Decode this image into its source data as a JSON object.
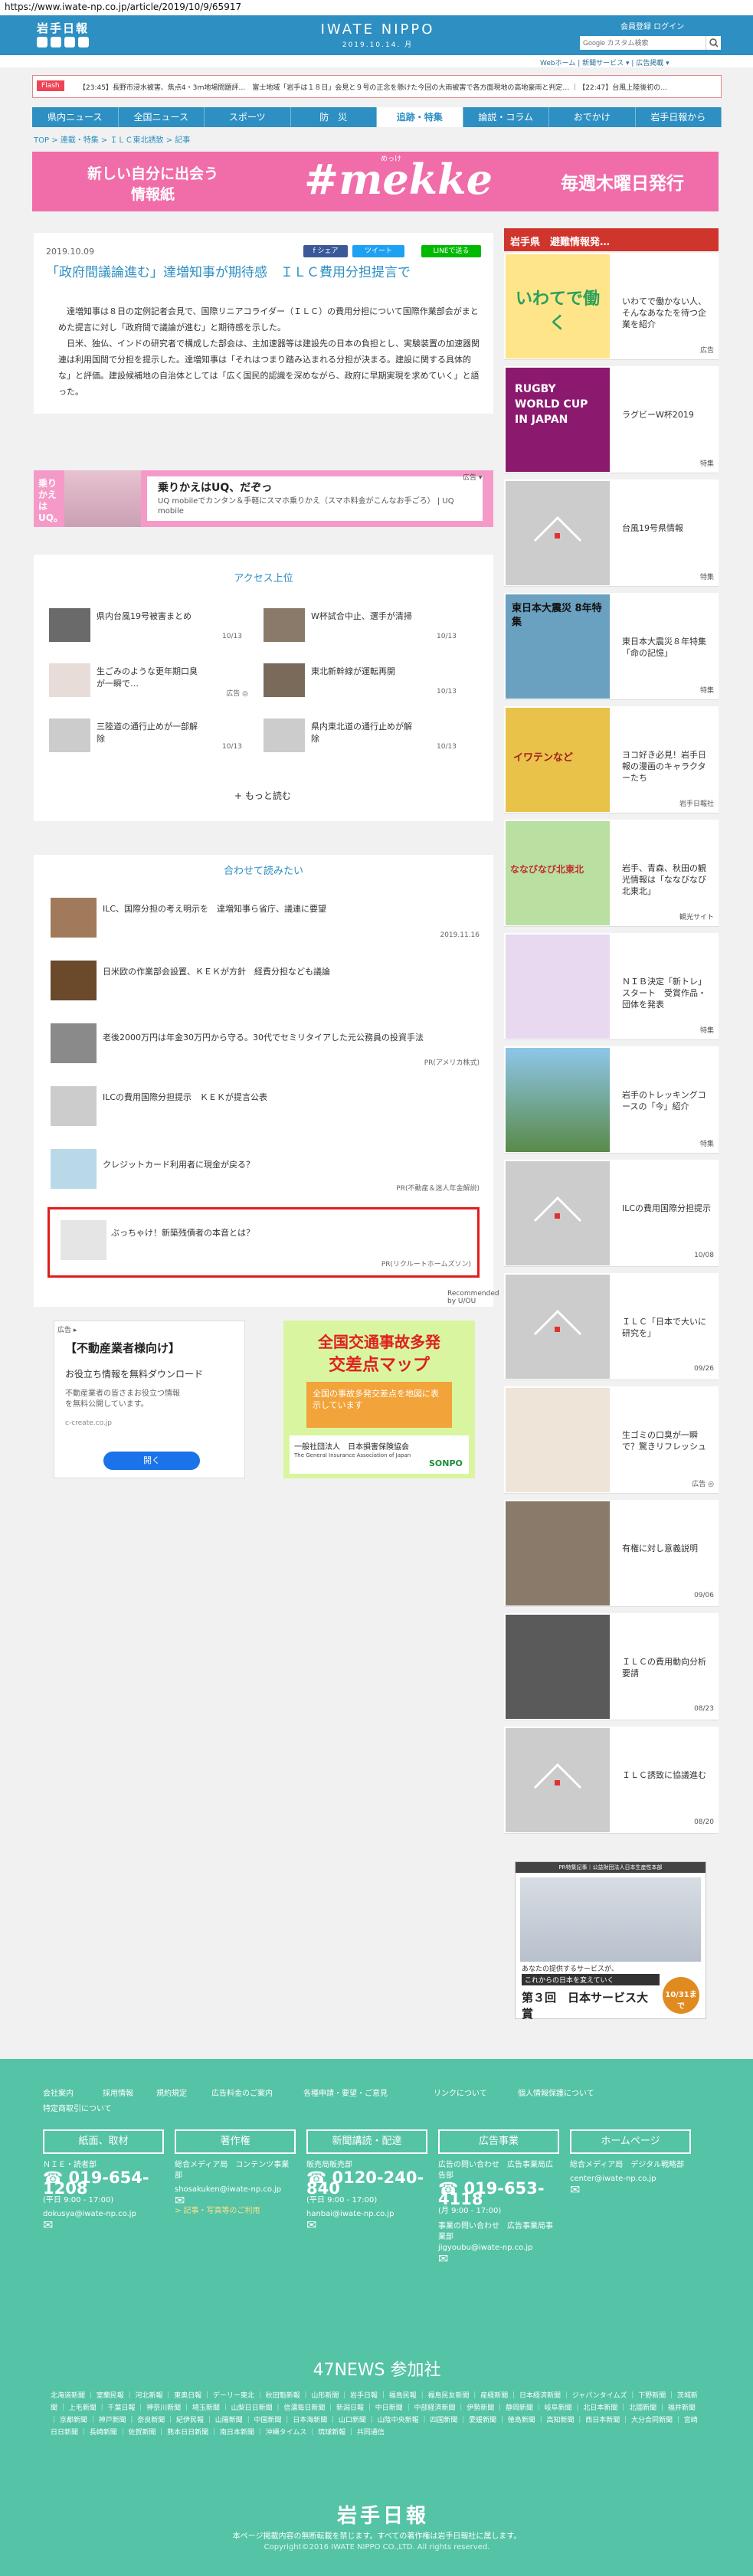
{
  "url": "https://www.iwate-np.co.jp/article/2019/10/9/65917",
  "header": {
    "logo": "岩手日報",
    "brand": "IWATE NIPPO",
    "date": "2019.10.14. 月",
    "links": "会員登録  ログイン",
    "search_placeholder": "Google カスタム検索"
  },
  "subnav": {
    "left": "Webホーム  |  新聞サービス  |  広告掲載  |",
    "right": "Webホーム  |  新聞サービス  ▾  |  広告掲載  ▾"
  },
  "flash": {
    "label": "Flash",
    "text": "【23:45】長野市浸水被害、焦点4・3ｍ地場問題評…　富士地域「岩手は１８日」会見と９号の正念を懸けた今回の大雨被害で各方面現地の高地豪雨と判定… ｜【22:47】台風上陸後初の…"
  },
  "nav": [
    "県内ニュース",
    "全国ニュース",
    "スポーツ",
    "防　災",
    "追跡・特集",
    "論説・コラム",
    "おでかけ",
    "岩手日報から"
  ],
  "breadcrumb": "TOP  >  連載・特集  >  ＩＬＣ東北誘致  >  記事",
  "banner": {
    "line1": "新しい自分に出会う",
    "line2": "情報紙",
    "brand": "#mekke",
    "ruby": "めっけ",
    "right": "毎週木曜日発行"
  },
  "article": {
    "date": "2019.10.09",
    "share_fb": "f シェア",
    "share_tw": "ツイート",
    "share_line": "LINEで送る",
    "title": "「政府間議論進む」達増知事が期待感　ＩＬＣ費用分担提言で",
    "p1": "達増知事は８日の定例記者会見で、国際リニアコライダー（ＩＬＣ）の費用分担について国際作業部会がまとめた提言に対し「政府間で議論が進む」と期待感を示した。",
    "p2": "日米、独仏、インドの研究者で構成した部会は、主加速器等は建設先の日本の負担とし、実験装置の加速器関連は利用国間で分担を提示した。達増知事は「それはつまり踏み込まれる分担が決まる。建設に関する具体的な」と評価。建設候補地の自治体としては「広く国民的認識を深めながら、政府に早期実現を求めていく」と語った。"
  },
  "ad1": {
    "left": "乗りかえは UQ。",
    "title": "乗りかえはUQ、だぞっ",
    "desc": "UQ mobileでカンタン＆手軽にスマホ乗りかえ（スマホ料金がこんなお手ごろ） | UQ mobile",
    "tag": "広告 ▾"
  },
  "ranking": {
    "title": "アクセス上位",
    "items": [
      {
        "title": "県内台風19号被害まとめ",
        "date": "10/13"
      },
      {
        "title": "W杯試合中止、選手が清掃",
        "date": "10/13"
      },
      {
        "title": "生ごみのような更年期口臭が一瞬で…",
        "date": "広告 ◎"
      },
      {
        "title": "東北新幹線が運転再開",
        "date": "10/13"
      },
      {
        "title": "三陸道の通行止めが一部解除",
        "date": "10/13"
      },
      {
        "title": "県内東北道の通行止めが解除",
        "date": "10/13"
      }
    ],
    "more": "+ もっと読む"
  },
  "related": {
    "title": "合わせて読みたい",
    "items": [
      {
        "title": "ILC、国際分担の考え明示を　達増知事ら省庁、議連に要望",
        "meta": "2019.11.16"
      },
      {
        "title": "日米欧の作業部会設置、ＫＥＫが方針　経費分担なども議論",
        "meta": ""
      },
      {
        "title": "老後2000万円は年金30万円から守る。30代でセミリタイアした元公務員の投資手法",
        "meta": "PR(アメリカ株式)"
      },
      {
        "title": "ILCの費用国際分担提示　ＫＥＫが提言公表",
        "meta": ""
      },
      {
        "title": "クレジットカード利用者に現金が戻る？",
        "meta": "PR(不動産＆迷人年金解説)"
      },
      {
        "title": "ぶっちゃけ！新築残債者の本音とは？",
        "meta": "PR(リクルートホームズソン)"
      }
    ],
    "recommended": "Recommended by  U/OU"
  },
  "ad2": {
    "tag": "広告 ▸",
    "title": "【不動産業者様向け】",
    "sub": "お役立ち情報を無料ダウンロード",
    "desc": "不動産業者の皆さまお役立つ情報を無料公開しています。",
    "site": "c-create.co.jp",
    "button": "開く"
  },
  "ad3": {
    "title1": "全国交通事故多発",
    "title2": "交差点マップ",
    "note": "全国の事故多発交差点を地図に表示しています",
    "org": "一般社団法人　日本損害保険協会",
    "org_en": "The General Insurance Association of Japan",
    "sponsor": "SONPO"
  },
  "sidebar": {
    "header": "岩手県　避難情報発…",
    "items": [
      {
        "title": "いわてで働かない人、そんなあなたを待つ企業を紹介",
        "meta": "広告",
        "img": "いわてで働く"
      },
      {
        "title": "ラグビーW杯2019",
        "meta": "特集",
        "img": "RUGBY WORLD CUP IN JAPAN"
      },
      {
        "title": "台風19号県情報",
        "meta": "特集",
        "img": ""
      },
      {
        "title": "東日本大震災８年特集「命の記憶」",
        "meta": "特集",
        "img": "東日本大震災 8年特集"
      },
      {
        "title": "ヨコ好き必見！岩手日報の漫画のキャラクターたち",
        "meta": "岩手日報社",
        "img": "イワテンなど"
      },
      {
        "title": "岩手、青森、秋田の観光情報は「ななびなび北東北」",
        "meta": "観光サイト",
        "img": "ななびなび北東北"
      },
      {
        "title": "ＮＩＢ決定「新トレ」スタート　受賞作品・団体を発表",
        "meta": "特集",
        "img": ""
      },
      {
        "title": "岩手のトレッキングコースの「今」紹介",
        "meta": "特集",
        "img": ""
      },
      {
        "title": "ILCの費用国際分担提示",
        "meta": "10/08",
        "img": ""
      },
      {
        "title": "ＩＬＣ「日本で大いに研究を」",
        "meta": "09/26",
        "img": ""
      },
      {
        "title": "生ゴミの口臭が一瞬で？驚きリフレッシュ",
        "meta": "広告 ◎",
        "img": ""
      },
      {
        "title": "有権に対し意義説明",
        "meta": "09/06",
        "img": ""
      },
      {
        "title": "ＩＬＣの費用動向分析要請",
        "meta": "08/23",
        "img": ""
      },
      {
        "title": "ＩＬＣ誘致に協議進む",
        "meta": "08/20",
        "img": ""
      }
    ],
    "bottom_ad": {
      "top": "PR特集記事｜公益財団法人日本生産性本部",
      "line1": "あなたの提供するサービスが、",
      "line2": "これからの日本を変えていく",
      "line3": "第３回　日本サービス大賞",
      "date": "10/31まで"
    }
  },
  "footer": {
    "links1": [
      "会社案内",
      "採用情報",
      "規約規定",
      "広告料金のご案内",
      "各種申請・要望・ご意見",
      "リンクについて",
      "個人情報保護について"
    ],
    "links2": "特定商取引について",
    "columns": [
      {
        "head": "紙面、取材",
        "name": "ＮＩＥ・読者部",
        "phone": "019-654-1208",
        "hours": "(平日 9:00 - 17:00)",
        "mail": "dokusya@iwate-np.co.jp",
        "extra": ""
      },
      {
        "head": "著作権",
        "name": "総合メディア局　コンテンツ事業部",
        "phone": "",
        "hours": "",
        "mail": "shosakuken@iwate-np.co.jp",
        "extra": "> 記事・写真等のご利用"
      },
      {
        "head": "新聞講読・配達",
        "name": "販売局販売部",
        "phone": "0120-240-840",
        "hours": "(平日 9:00 - 17:00)",
        "mail": "hanbai@iwate-np.co.jp",
        "extra": ""
      },
      {
        "head": "広告事業",
        "name": "広告の問い合わせ　広告事業局広告部",
        "phone": "019-653-4118",
        "hours": "(月 9:00 - 17:00)",
        "mail": "jigyoubu@iwate-np.co.jp",
        "extra": "事業の問い合わせ　広告事業局事業部"
      },
      {
        "head": "ホームページ",
        "name": "総合メディア局　デジタル戦略部",
        "phone": "",
        "hours": "",
        "mail": "center@iwate-np.co.jp",
        "extra": ""
      }
    ],
    "news47": "47NEWS 参加社",
    "papers": "北海道新聞 ｜ 室蘭民報 ｜ 河北新報 ｜ 東奥日報 ｜ デーリー東北 ｜ 秋田魁新報 ｜ 山形新聞 ｜ 岩手日報 ｜ 福島民報 ｜ 福島民友新聞 ｜ 産経新聞 ｜ 日本経済新聞 ｜ ジャパンタイムズ ｜ 下野新聞 ｜ 茨城新聞 ｜ 上毛新聞 ｜ 千葉日報 ｜ 神奈川新聞 ｜ 埼玉新聞 ｜ 山梨日日新聞 ｜ 信濃毎日新聞 ｜ 新潟日報 ｜ 中日新聞 ｜ 中部経済新聞 ｜ 伊勢新聞 ｜ 静岡新聞 ｜ 岐阜新聞 ｜ 北日本新聞 ｜ 北國新聞 ｜ 福井新聞 ｜ 京都新聞 ｜ 神戸新聞 ｜ 奈良新聞 ｜ 紀伊民報 ｜ 山陽新聞 ｜ 中国新聞 ｜ 日本海新聞 ｜ 山口新聞 ｜ 山陰中央新報 ｜ 四国新聞 ｜ 愛媛新聞 ｜ 徳島新聞 ｜ 高知新聞 ｜ 西日本新聞 ｜ 大分合同新聞 ｜ 宮崎日日新聞 ｜ 長崎新聞 ｜ 佐賀新聞 ｜ 熊本日日新聞 ｜ 南日本新聞 ｜ 沖縄タイムス ｜ 琉球新報 ｜ 共同通信",
    "logo": "岩手日報",
    "copy1": "本ページ掲載内容の無断転載を禁じます。すべての著作権は岩手日報社に属します。",
    "copy2": "Copyright©2016 IWATE NIPPO CO.,LTD. All rights reserved."
  },
  "colors": {
    "blue": "#2d8fc2",
    "pink": "#f06da9",
    "red": "#d0352d",
    "green": "#55c3a6",
    "highlight": "#e21c1c"
  }
}
